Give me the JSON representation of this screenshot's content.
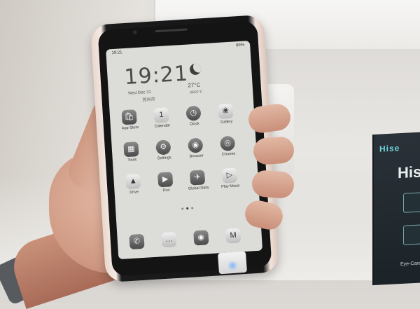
{
  "status_bar": {
    "time": "19:21",
    "battery": "89%"
  },
  "clock": {
    "time": "19:21",
    "date": "Wed Dec 31",
    "location": "苏州市",
    "temperature": "27°C",
    "temp_range": "30/22°C"
  },
  "apps": [
    {
      "label": "App Store",
      "icon": "shopping-bag-icon",
      "glyph": "🛍"
    },
    {
      "label": "Calendar",
      "icon": "calendar-icon",
      "glyph": "1"
    },
    {
      "label": "Clock",
      "icon": "clock-icon",
      "glyph": "◷"
    },
    {
      "label": "Gallery",
      "icon": "gallery-icon",
      "glyph": "❀"
    },
    {
      "label": "Tools",
      "icon": "tools-icon",
      "glyph": "▦"
    },
    {
      "label": "Settings",
      "icon": "gear-icon",
      "glyph": "⚙"
    },
    {
      "label": "Browser",
      "icon": "browser-icon",
      "glyph": "◉"
    },
    {
      "label": "Chrome",
      "icon": "chrome-icon",
      "glyph": "◎"
    },
    {
      "label": "Drive",
      "icon": "drive-icon",
      "glyph": "▲"
    },
    {
      "label": "Duo",
      "icon": "video-call-icon",
      "glyph": "▶"
    },
    {
      "label": "Global Data",
      "icon": "airplane-icon",
      "glyph": "✈"
    },
    {
      "label": "Play Music",
      "icon": "play-music-icon",
      "glyph": "▷"
    }
  ],
  "dock": [
    {
      "icon": "phone-icon",
      "glyph": "✆"
    },
    {
      "icon": "messages-icon",
      "glyph": "…"
    },
    {
      "icon": "camera-icon",
      "glyph": "◉"
    },
    {
      "icon": "gmail-icon",
      "glyph": "M"
    }
  ],
  "sign": {
    "brand": "Hise",
    "title": "His",
    "footer": "Eye-Care E"
  }
}
